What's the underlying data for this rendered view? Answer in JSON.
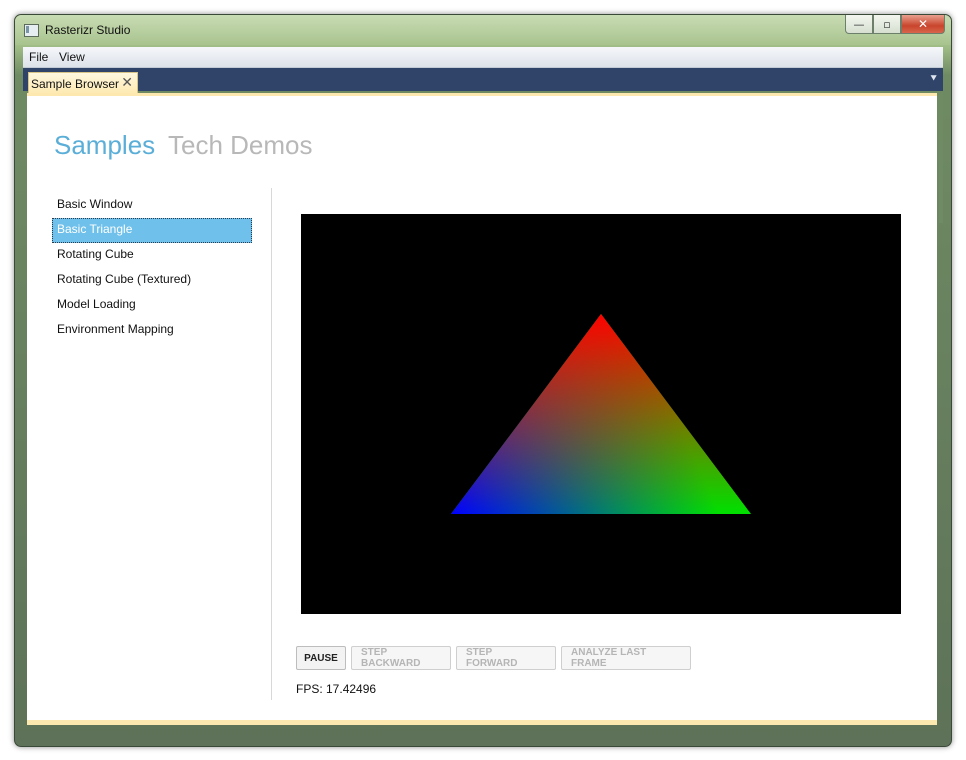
{
  "window": {
    "title": "Rasterizr Studio",
    "controls": {
      "minimize": "—",
      "maximize": "▫",
      "close": "✕"
    }
  },
  "menu": {
    "items": [
      "File",
      "View"
    ]
  },
  "tabs": [
    {
      "label": "Sample Browser",
      "close": "✕"
    }
  ],
  "tab_overflow": "⯆",
  "headings": {
    "active": "Samples",
    "inactive": "Tech Demos"
  },
  "samples": {
    "items": [
      "Basic Window",
      "Basic Triangle",
      "Rotating Cube",
      "Rotating Cube (Textured)",
      "Model Loading",
      "Environment Mapping"
    ],
    "selected_index": 1
  },
  "viewport": {
    "background": "#000000",
    "triangle_vertex_colors": {
      "top": "#ff0000",
      "left": "#0000ff",
      "right": "#00ff00"
    }
  },
  "buttons": {
    "pause": "PAUSE",
    "step_backward": "STEP BACKWARD",
    "step_forward": "STEP FORWARD",
    "analyze": "ANALYZE LAST FRAME"
  },
  "status": {
    "fps": "FPS: 17.42496"
  },
  "colors": {
    "accent": "#5aaed8",
    "selection": "#6fc0ea",
    "tab": "#fde9b0",
    "tabstrip": "#2f4468"
  }
}
